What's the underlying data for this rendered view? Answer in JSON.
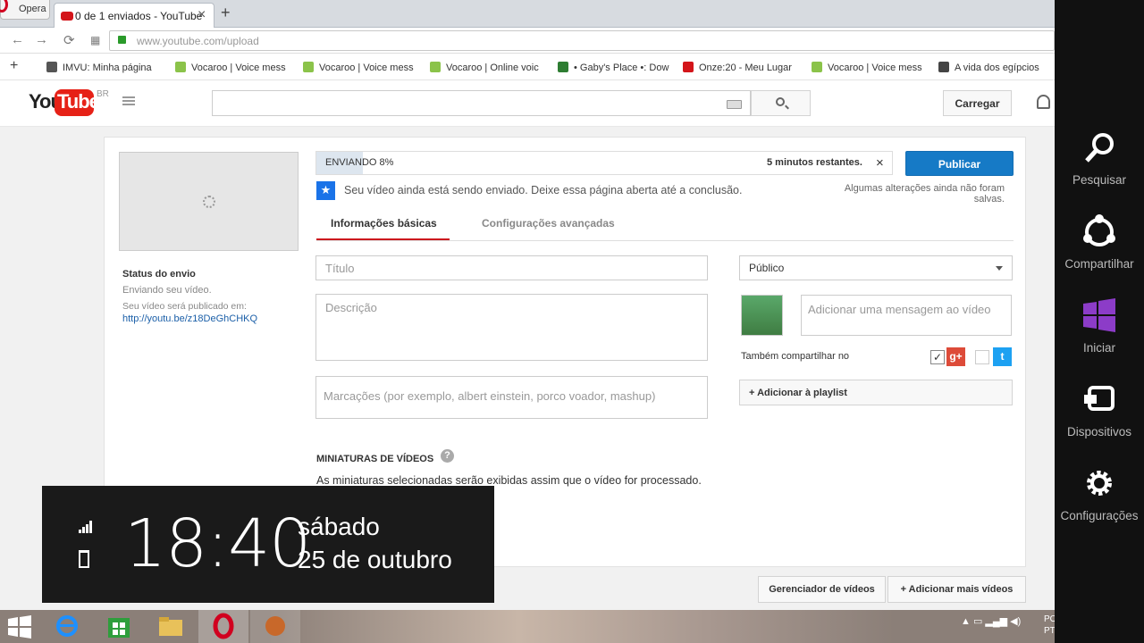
{
  "browser": {
    "menu_label": "Opera",
    "tab_title": "0 de 1 enviados - YouTube",
    "url_domain": "www.youtube.com",
    "url_path": "/upload",
    "bookmarks": [
      {
        "label": "IMVU: Minha página",
        "color": "#555555"
      },
      {
        "label": "Vocaroo | Voice mess",
        "color": "#8bc34a"
      },
      {
        "label": "Vocaroo | Voice mess",
        "color": "#8bc34a"
      },
      {
        "label": "Vocaroo | Online voic",
        "color": "#8bc34a"
      },
      {
        "label": "• Gaby's Place •: Dow",
        "color": "#2e7d32"
      },
      {
        "label": "Onze:20 - Meu Lugar",
        "color": "#d3151a"
      },
      {
        "label": "Vocaroo | Voice mess",
        "color": "#8bc34a"
      },
      {
        "label": "A vida dos egípcios",
        "color": "#444444"
      }
    ]
  },
  "header": {
    "logo_you": "You",
    "logo_tube": "Tube",
    "region": "BR",
    "upload_label": "Carregar"
  },
  "sidebar": {
    "status_title": "Status do envio",
    "status_sub": "Enviando seu vídeo.",
    "publish_info": "Seu vídeo será publicado em:",
    "link": "http://youtu.be/z18DeGhCHKQ"
  },
  "upload": {
    "progress_label": "ENVIANDO 8%",
    "progress_fraction": 0.08,
    "remaining": "5 minutos restantes.",
    "close": "×",
    "publish_label": "Publicar",
    "notice": "Seu vídeo ainda está sendo enviado. Deixe essa página aberta até a conclusão.",
    "unsaved": "Algumas alterações ainda não foram salvas."
  },
  "tabs": {
    "basic": "Informações básicas",
    "advanced": "Configurações avançadas"
  },
  "form": {
    "title_placeholder": "Título",
    "desc_placeholder": "Descrição",
    "tags_placeholder": "Marcações (por exemplo, albert einstein, porco voador, mashup)",
    "visibility": "Público",
    "message_placeholder": "Adicionar uma mensagem ao vídeo",
    "share_label": "Também compartilhar no",
    "gplus": "g+",
    "twitter": "t",
    "playlist_label": "+ Adicionar à playlist"
  },
  "thumbnails": {
    "heading": "MINIATURAS DE VÍDEOS",
    "help": "?",
    "text": "As miniaturas selecionadas serão exibidas assim que o vídeo for processado."
  },
  "footer_buttons": {
    "manager": "Gerenciador de vídeos",
    "add_more": "+ Adicionar mais vídeos"
  },
  "clock": {
    "time": "18:40",
    "day": "sábado",
    "date": "25 de outubro"
  },
  "charms": [
    {
      "label": "Pesquisar",
      "icon": "search-icon"
    },
    {
      "label": "Compartilhar",
      "icon": "share-icon"
    },
    {
      "label": "Iniciar",
      "icon": "windows-icon"
    },
    {
      "label": "Dispositivos",
      "icon": "devices-icon"
    },
    {
      "label": "Configurações",
      "icon": "gear-icon"
    }
  ],
  "tray": {
    "lang": "PO PT"
  }
}
